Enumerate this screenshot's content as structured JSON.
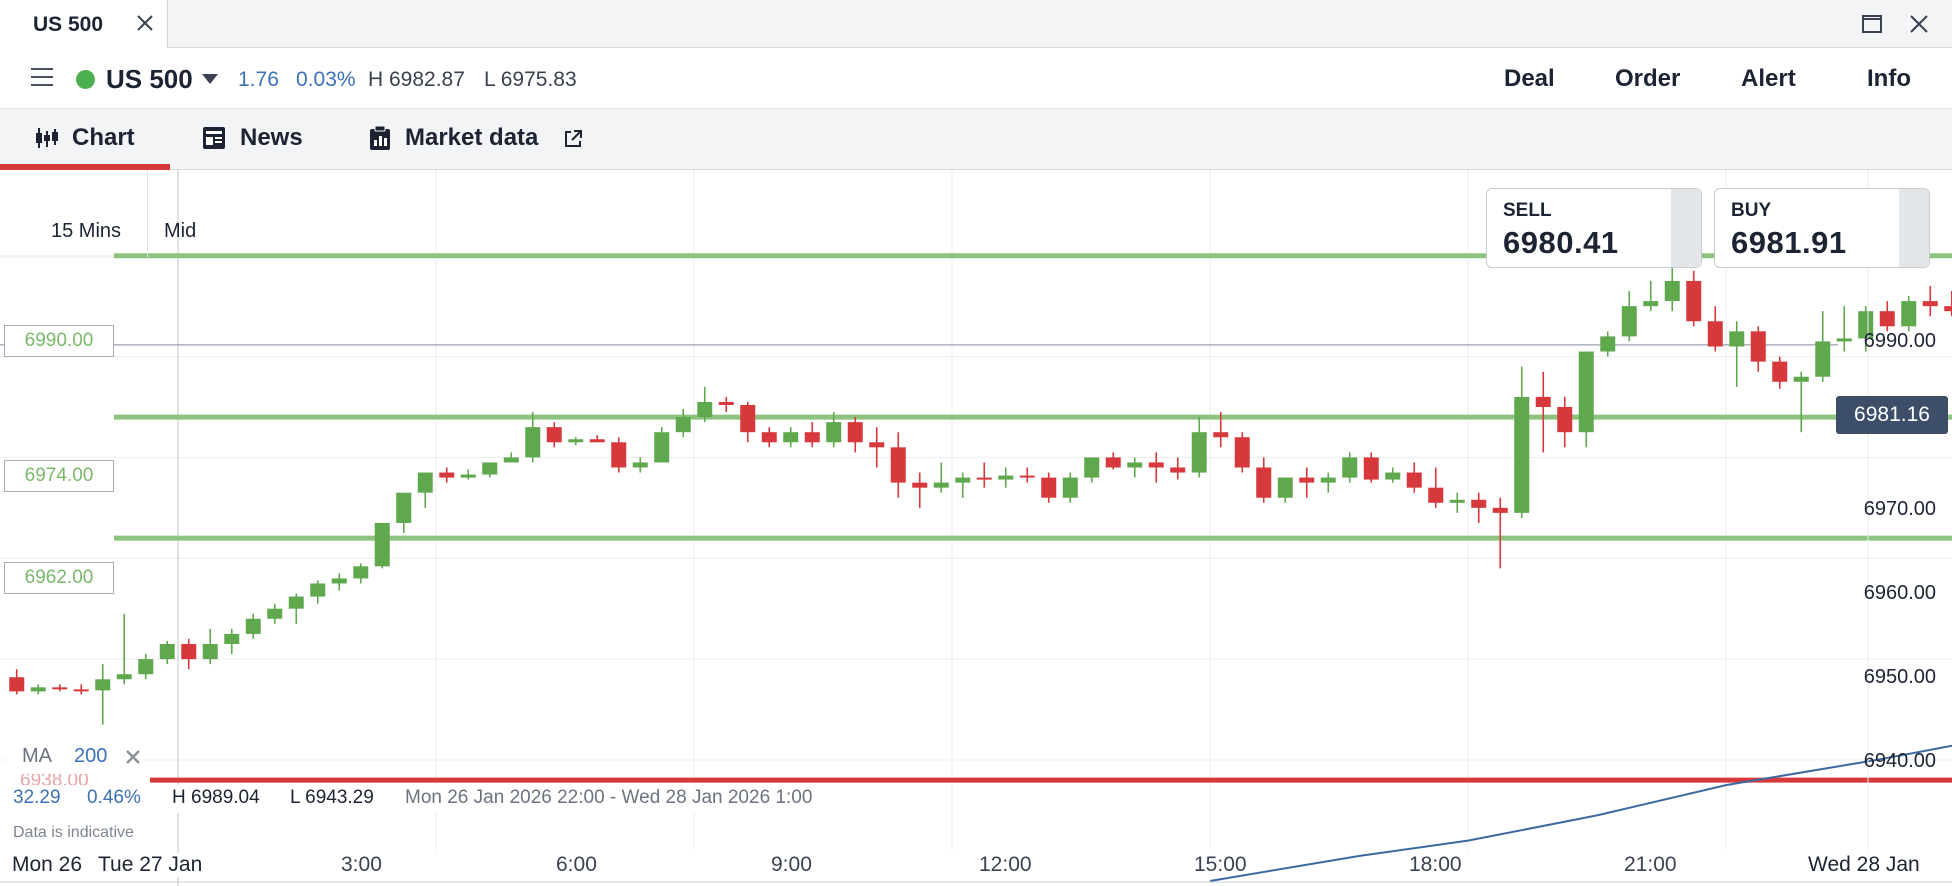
{
  "window": {
    "tab_title": "US 500"
  },
  "header": {
    "instrument_name": "US 500",
    "change": "1.76",
    "change_pct": "0.03%",
    "high": "H 6982.87",
    "low": "L 6975.83",
    "actions": [
      "Deal",
      "Order",
      "Alert",
      "Info"
    ]
  },
  "tabs": {
    "chart": "Chart",
    "news": "News",
    "market_data": "Market data"
  },
  "chart_toolbar": {
    "timeframe": "15 Mins",
    "price_type": "Mid"
  },
  "sell": {
    "label": "SELL",
    "price": "6980.41"
  },
  "buy": {
    "label": "BUY",
    "price": "6981.91"
  },
  "levels": [
    "6990.00",
    "6974.00",
    "6962.00"
  ],
  "ghost_level": "6938.00",
  "current_price": "6981.16",
  "ma": {
    "name": "MA",
    "period": "200"
  },
  "stats": {
    "change": "32.29",
    "change_pct": "0.46%",
    "high": "H 6989.04",
    "low": "L 6943.29",
    "range": "Mon 26 Jan 2026 22:00 - Wed 28 Jan 2026 1:00"
  },
  "disclaimer": "Data is indicative",
  "colors": {
    "up": "#5fa84e",
    "down": "#d7383b",
    "level": "#8cc47f",
    "ma": "#3d6a9e",
    "accent": "#d7383b"
  },
  "chart_data": {
    "type": "candlestick",
    "x_ticks": [
      "Mon 26",
      "Tue 27 Jan",
      "3:00",
      "6:00",
      "9:00",
      "12:00",
      "15:00",
      "18:00",
      "21:00",
      "Wed 28 Jan"
    ],
    "y_ticks": [
      "6990.00",
      "6970.00",
      "6960.00",
      "6950.00",
      "6940.00"
    ],
    "ylim": [
      6927.5,
      6998.5
    ],
    "grid": true,
    "bar_interval_minutes": 15,
    "first_bar": "Mon 26 Jan 22:00",
    "horizontal_levels": [
      6990,
      6974,
      6962,
      6938
    ],
    "current_price": 6981.16,
    "candles": [
      [
        6948.2,
        6949.0,
        6946.5,
        6946.8
      ],
      [
        6946.8,
        6947.5,
        6946.5,
        6947.2
      ],
      [
        6947.2,
        6947.5,
        6946.8,
        6947.0
      ],
      [
        6947.0,
        6947.5,
        6946.5,
        6946.9
      ],
      [
        6946.9,
        6949.5,
        6943.5,
        6948.0
      ],
      [
        6948.0,
        6954.5,
        6947.5,
        6948.5
      ],
      [
        6948.5,
        6950.5,
        6948.0,
        6950.0
      ],
      [
        6950.0,
        6951.8,
        6949.5,
        6951.5
      ],
      [
        6951.5,
        6952.0,
        6949.0,
        6950.0
      ],
      [
        6950.0,
        6953.0,
        6949.5,
        6951.5
      ],
      [
        6951.5,
        6953.0,
        6950.5,
        6952.5
      ],
      [
        6952.5,
        6954.5,
        6952.0,
        6954.0
      ],
      [
        6954.0,
        6955.5,
        6953.5,
        6955.0
      ],
      [
        6955.0,
        6956.5,
        6953.5,
        6956.2
      ],
      [
        6956.2,
        6957.8,
        6955.5,
        6957.5
      ],
      [
        6957.5,
        6958.5,
        6956.8,
        6958.0
      ],
      [
        6958.0,
        6959.5,
        6957.5,
        6959.2
      ],
      [
        6959.2,
        6963.0,
        6959.0,
        6963.5
      ],
      [
        6963.5,
        6964.0,
        6962.5,
        6966.5
      ],
      [
        6966.5,
        6967.0,
        6965.0,
        6968.5
      ],
      [
        6968.5,
        6969.0,
        6967.5,
        6968.0
      ],
      [
        6968.0,
        6968.8,
        6967.8,
        6968.3
      ],
      [
        6968.3,
        6969.5,
        6968.0,
        6969.5
      ],
      [
        6969.5,
        6970.5,
        6969.5,
        6970.0
      ],
      [
        6970.0,
        6974.5,
        6969.5,
        6973.0
      ],
      [
        6973.0,
        6973.5,
        6971.0,
        6971.5
      ],
      [
        6971.5,
        6972.0,
        6971.2,
        6971.8
      ],
      [
        6971.8,
        6972.2,
        6971.5,
        6971.5
      ],
      [
        6971.5,
        6972.0,
        6968.5,
        6969.0
      ],
      [
        6969.0,
        6970.0,
        6968.5,
        6969.5
      ],
      [
        6969.5,
        6973.0,
        6969.5,
        6972.5
      ],
      [
        6972.5,
        6974.8,
        6972.0,
        6974.0
      ],
      [
        6974.0,
        6977.0,
        6973.5,
        6975.5
      ],
      [
        6975.5,
        6976.0,
        6974.5,
        6975.2
      ],
      [
        6975.2,
        6975.5,
        6971.5,
        6972.5
      ],
      [
        6972.5,
        6973.0,
        6971.0,
        6971.5
      ],
      [
        6971.5,
        6973.0,
        6971.0,
        6972.5
      ],
      [
        6972.5,
        6973.5,
        6971.0,
        6971.5
      ],
      [
        6971.5,
        6974.5,
        6971.0,
        6973.5
      ],
      [
        6973.5,
        6974.0,
        6970.5,
        6971.5
      ],
      [
        6971.5,
        6973.0,
        6969.0,
        6971.0
      ],
      [
        6971.0,
        6972.5,
        6966.0,
        6967.5
      ],
      [
        6967.5,
        6968.5,
        6965.0,
        6967.0
      ],
      [
        6967.0,
        6969.5,
        6966.5,
        6967.5
      ],
      [
        6967.5,
        6968.5,
        6966.0,
        6968.0
      ],
      [
        6968.0,
        6969.5,
        6967.0,
        6967.8
      ],
      [
        6967.8,
        6969.0,
        6967.0,
        6968.2
      ],
      [
        6968.2,
        6969.0,
        6967.5,
        6968.0
      ],
      [
        6968.0,
        6968.5,
        6965.5,
        6966.0
      ],
      [
        6966.0,
        6968.5,
        6965.5,
        6968.0
      ],
      [
        6968.0,
        6969.0,
        6967.5,
        6970.0
      ],
      [
        6970.0,
        6970.5,
        6968.8,
        6969.0
      ],
      [
        6969.0,
        6970.0,
        6968.0,
        6969.5
      ],
      [
        6969.5,
        6970.5,
        6967.5,
        6969.0
      ],
      [
        6969.0,
        6970.0,
        6967.8,
        6968.5
      ],
      [
        6968.5,
        6974.0,
        6968.0,
        6972.5
      ],
      [
        6972.5,
        6974.5,
        6971.0,
        6972.0
      ],
      [
        6972.0,
        6972.5,
        6968.5,
        6969.0
      ],
      [
        6969.0,
        6970.0,
        6965.5,
        6966.0
      ],
      [
        6966.0,
        6968.0,
        6965.5,
        6968.0
      ],
      [
        6968.0,
        6969.0,
        6966.0,
        6967.5
      ],
      [
        6967.5,
        6968.5,
        6966.5,
        6968.0
      ],
      [
        6968.0,
        6970.5,
        6967.5,
        6970.0
      ],
      [
        6970.0,
        6970.5,
        6967.5,
        6967.8
      ],
      [
        6967.8,
        6969.0,
        6967.5,
        6968.5
      ],
      [
        6968.5,
        6969.5,
        6966.5,
        6967.0
      ],
      [
        6967.0,
        6969.0,
        6965.0,
        6965.5
      ],
      [
        6965.5,
        6966.5,
        6964.5,
        6965.8
      ],
      [
        6965.8,
        6966.5,
        6963.5,
        6965.0
      ],
      [
        6965.0,
        6966.0,
        6959.0,
        6964.5
      ],
      [
        6964.5,
        6979.0,
        6964.0,
        6976.0
      ],
      [
        6976.0,
        6978.5,
        6970.5,
        6975.0
      ],
      [
        6975.0,
        6976.0,
        6971.0,
        6972.5
      ],
      [
        6972.5,
        6974.5,
        6971.0,
        6980.5
      ],
      [
        6980.5,
        6982.5,
        6980.0,
        6982.0
      ],
      [
        6982.0,
        6986.5,
        6981.5,
        6985.0
      ],
      [
        6985.0,
        6987.5,
        6984.5,
        6985.5
      ],
      [
        6985.5,
        6989.0,
        6984.5,
        6987.5
      ],
      [
        6987.5,
        6988.5,
        6983.0,
        6983.5
      ],
      [
        6983.5,
        6985.0,
        6980.5,
        6981.0
      ],
      [
        6981.0,
        6983.5,
        6977.0,
        6982.5
      ],
      [
        6982.5,
        6983.0,
        6978.5,
        6979.5
      ],
      [
        6979.5,
        6980.0,
        6976.8,
        6977.5
      ],
      [
        6977.5,
        6978.5,
        6972.5,
        6978.0
      ],
      [
        6978.0,
        6984.5,
        6977.5,
        6981.5
      ],
      [
        6981.5,
        6985.0,
        6980.5,
        6981.8
      ],
      [
        6981.8,
        6985.0,
        6980.5,
        6984.5
      ],
      [
        6984.5,
        6985.5,
        6982.5,
        6983.0
      ],
      [
        6983.0,
        6986.0,
        6982.5,
        6985.5
      ],
      [
        6985.5,
        6987.0,
        6984.0,
        6985.0
      ],
      [
        6985.0,
        6986.5,
        6984.0,
        6984.5
      ],
      [
        6984.5,
        6987.0,
        6983.0,
        6987.5
      ],
      [
        6987.5,
        6988.0,
        6982.5,
        6983.0
      ],
      [
        6983.0,
        6984.0,
        6982.0,
        6982.5
      ],
      [
        6982.5,
        6985.0,
        6978.0,
        6979.0
      ],
      [
        6979.0,
        6980.5,
        6976.5,
        6977.0
      ],
      [
        6977.0,
        6979.5,
        6976.5,
        6978.5
      ],
      [
        6978.5,
        6982.0,
        6978.0,
        6981.5
      ],
      [
        6981.5,
        6982.0,
        6979.5,
        6980.5
      ],
      [
        6980.5,
        6981.5,
        6979.0,
        6980.8
      ],
      [
        6980.8,
        6982.0,
        6980.0,
        6980.4
      ],
      [
        6980.4,
        6981.2,
        6980.2,
        6981.2
      ]
    ],
    "ma_series": [
      {
        "time": "Tue 27 Jan 12:00",
        "value": 6928.0
      },
      {
        "time": "Tue 27 Jan 13:45",
        "value": 6930.5
      },
      {
        "time": "Tue 27 Jan 15:00",
        "value": 6932.0
      },
      {
        "time": "Tue 27 Jan 16:30",
        "value": 6934.5
      },
      {
        "time": "Tue 27 Jan 18:00",
        "value": 6937.5
      },
      {
        "time": "Tue 27 Jan 19:45",
        "value": 6940.0
      },
      {
        "time": "Tue 27 Jan 21:00",
        "value": 6942.0
      },
      {
        "time": "Tue 27 Jan 22:30",
        "value": 6944.0
      }
    ]
  }
}
